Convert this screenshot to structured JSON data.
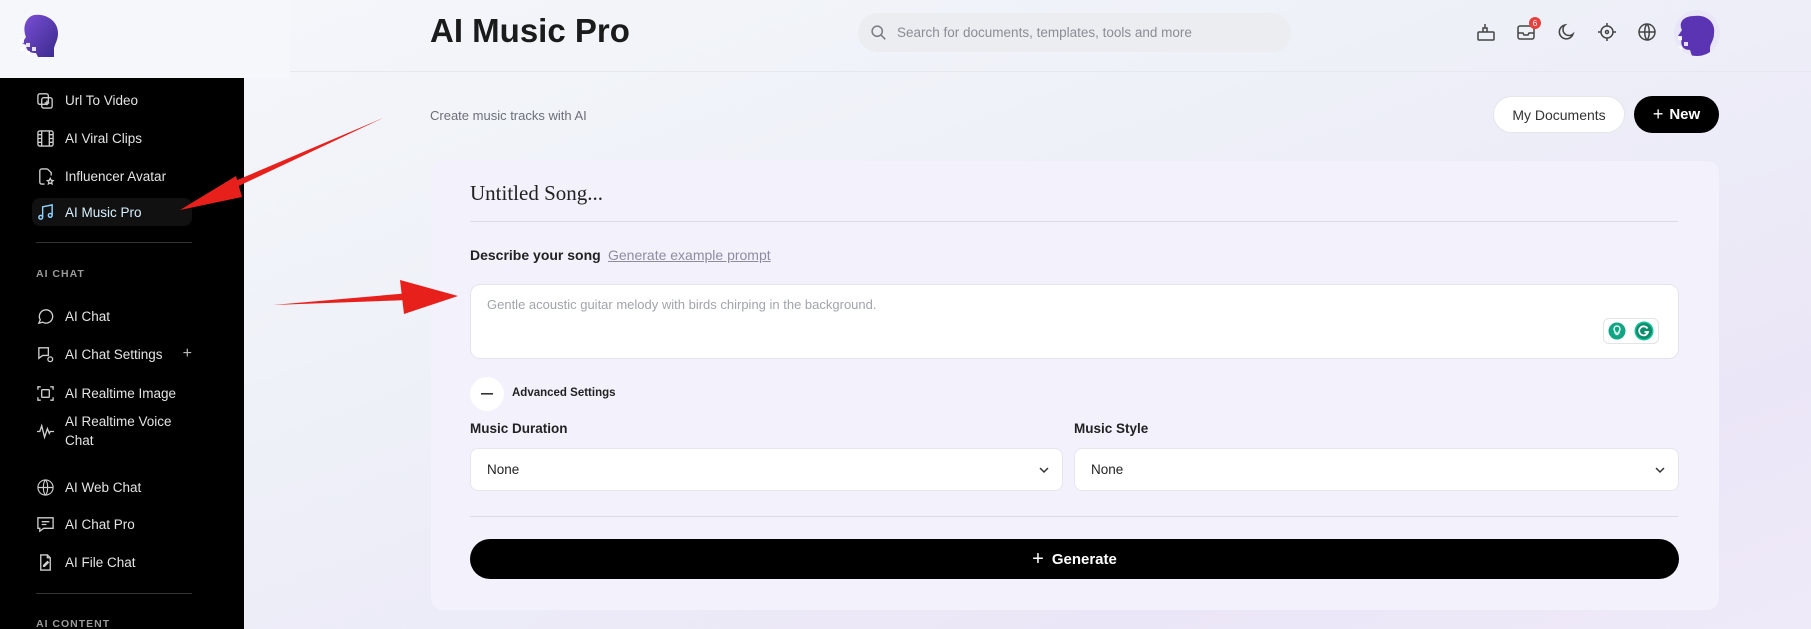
{
  "header": {
    "title": "AI Music Pro",
    "search_placeholder": "Search for documents, templates, tools and more",
    "notification_count": "6"
  },
  "page": {
    "subtitle": "Create music tracks with AI",
    "my_documents_label": "My Documents",
    "new_label": "New"
  },
  "sidebar": {
    "items_top": [
      {
        "label": "Url To Video",
        "icon": "video-plus-icon"
      },
      {
        "label": "AI Viral Clips",
        "icon": "film-icon"
      },
      {
        "label": "Influencer Avatar",
        "icon": "avatar-doc-icon"
      },
      {
        "label": "AI Music Pro",
        "icon": "music-note-icon"
      }
    ],
    "section_chat": "AI CHAT",
    "items_chat": [
      {
        "label": "AI Chat",
        "icon": "chat-bubble-icon"
      },
      {
        "label": "AI Chat Settings",
        "icon": "chat-settings-icon"
      },
      {
        "label": "AI Realtime Image",
        "icon": "realtime-image-icon"
      },
      {
        "label": "AI Realtime Voice Chat",
        "icon": "waveform-icon"
      },
      {
        "label": "AI Web Chat",
        "icon": "www-icon"
      },
      {
        "label": "AI Chat Pro",
        "icon": "chat-pro-icon"
      },
      {
        "label": "AI File Chat",
        "icon": "file-chat-icon"
      }
    ],
    "section_content": "AI CONTENT",
    "settings_plus": "+"
  },
  "form": {
    "song_title": "Untitled Song...",
    "describe_label": "Describe your song",
    "example_link": "Generate example prompt",
    "prompt_placeholder": "Gentle acoustic guitar melody with birds chirping in the background.",
    "advanced_label": "Advanced Settings",
    "duration_label": "Music Duration",
    "duration_value": "None",
    "style_label": "Music Style",
    "style_value": "None",
    "generate_label": "Generate"
  },
  "colors": {
    "accent": "#000000",
    "sidebar_bg": "#000000",
    "active_item_text": "#d7f0ff",
    "annotation_arrow": "#e8201c",
    "badge": "#e8403d"
  }
}
